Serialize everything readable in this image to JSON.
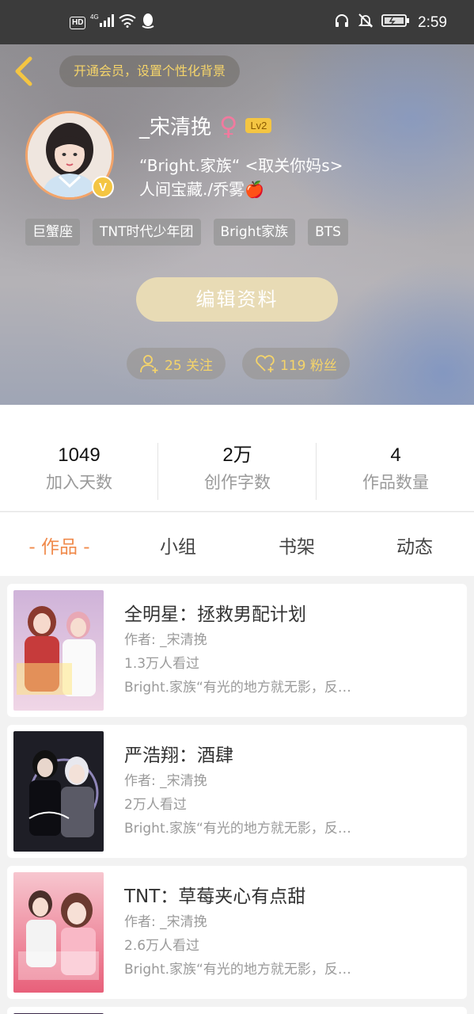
{
  "status_bar": {
    "hd": "HD",
    "network": "4G",
    "time": "2:59"
  },
  "header": {
    "vip_text": "开通会员，设置个性化背景",
    "username": "_宋清挽",
    "gender_symbol": "♀",
    "level": "Lv2",
    "verified_badge": "V",
    "bio_line1": "“Bright.家族“ <取关你妈s>",
    "bio_line2": "人间宝藏./乔雾🍎",
    "tags": [
      "巨蟹座",
      "TNT时代少年团",
      "Bright家族",
      "BTS"
    ],
    "edit_button": "编辑资料",
    "follow_count_text": "25 关注",
    "fans_count_text": "119 粉丝"
  },
  "stats": [
    {
      "value": "1049",
      "label": "加入天数"
    },
    {
      "value": "2万",
      "label": "创作字数"
    },
    {
      "value": "4",
      "label": "作品数量"
    }
  ],
  "tabs": [
    "- 作品 -",
    "小组",
    "书架",
    "动态"
  ],
  "works": [
    {
      "title": "全明星：拯救男配计划",
      "author": "作者: _宋清挽",
      "views": "1.3万人看过",
      "desc": "Bright.家族“有光的地方就无影，反…"
    },
    {
      "title": "严浩翔：酒肆",
      "author": "作者: _宋清挽",
      "views": "2万人看过",
      "desc": "Bright.家族“有光的地方就无影，反…"
    },
    {
      "title": "TNT：草莓夹心有点甜",
      "author": "作者: _宋清挽",
      "views": "2.6万人看过",
      "desc": "Bright.家族“有光的地方就无影，反…"
    }
  ],
  "colors": {
    "accent_orange": "#f08a4b",
    "vip_gold": "#f5d46a",
    "edit_button_bg": "#e8dbb5",
    "gender_pink": "#f07a9e"
  }
}
